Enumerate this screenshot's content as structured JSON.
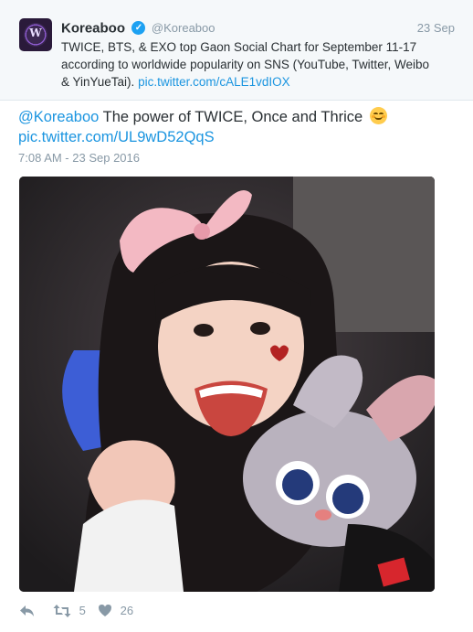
{
  "quoted_tweet": {
    "author_name": "Koreaboo",
    "author_handle": "@Koreaboo",
    "date": "23 Sep",
    "avatar_mark": "W",
    "text_line1": "TWICE, BTS, & EXO top Gaon Social Chart for September 11-17",
    "text_line2": "according to worldwide popularity on SNS (YouTube, Twitter, Weibo",
    "text_line3": "& YinYueTai).",
    "link": "pic.twitter.com/cALE1vdIOX"
  },
  "tweet": {
    "mention": "@Koreaboo",
    "text": "The power of TWICE, Once and Thrice",
    "emoji": "relieved-face-emoji",
    "link": "pic.twitter.com/UL9wD52QqS",
    "timestamp": "7:08 AM - 23 Sep 2016"
  },
  "actions": {
    "reply_icon": "reply-icon",
    "retweet_icon": "retweet-icon",
    "retweet_count": "5",
    "like_icon": "heart-icon",
    "like_count": "26"
  },
  "colors": {
    "link": "#1b95e0",
    "muted": "#8899a6",
    "text": "#292f33",
    "quoted_bg": "#f5f8fa",
    "verified": "#1da1f2"
  }
}
